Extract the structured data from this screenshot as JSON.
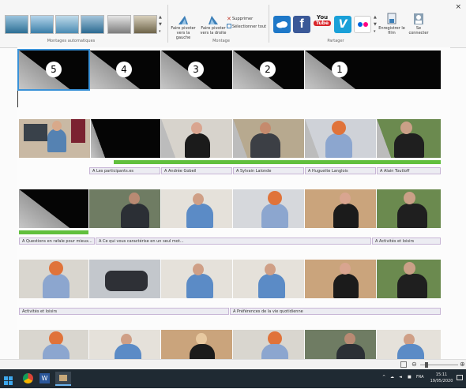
{
  "ribbon": {
    "groups": {
      "auto": "Montages automatiques",
      "montage": "Montage",
      "partager": "Partager"
    },
    "buttons": {
      "rotate_left": "Faire pivoter vers la gauche",
      "rotate_right": "Faire pivoter vers la droite",
      "supprimer": "Supprimer",
      "select_all": "Sélectionner tout",
      "save": "Enregistrer le film",
      "signin": "Se connecter"
    },
    "share": {
      "youtube": "You",
      "youtube2": "Tube",
      "vimeo": "V",
      "facebook": "f"
    }
  },
  "timeline": {
    "title_numbers": [
      "5",
      "4",
      "3",
      "2",
      "1"
    ],
    "row2_captions": [
      "A Les participants.es",
      "A Andrée Gobeil",
      "A Sylvain Lalonde",
      "A Huguette Langlois",
      "A Alain Toutloff"
    ],
    "row3_captions": [
      "A Questions en rafale pour mieux...",
      "A Ce qui vous caractérise en un seul mot...",
      "A Activités et loisirs"
    ],
    "row4_captions": [
      "Activités et loisirs",
      "A Préférences de la vie quotidienne"
    ]
  },
  "taskbar": {
    "lang": "FRA",
    "time": "15:11",
    "date": "19/05/2020"
  },
  "colors": {
    "accent_green": "#61bf3d",
    "caption_bg": "#ececf2",
    "selection": "#3a92d8",
    "taskbar": "#1f2a33"
  }
}
